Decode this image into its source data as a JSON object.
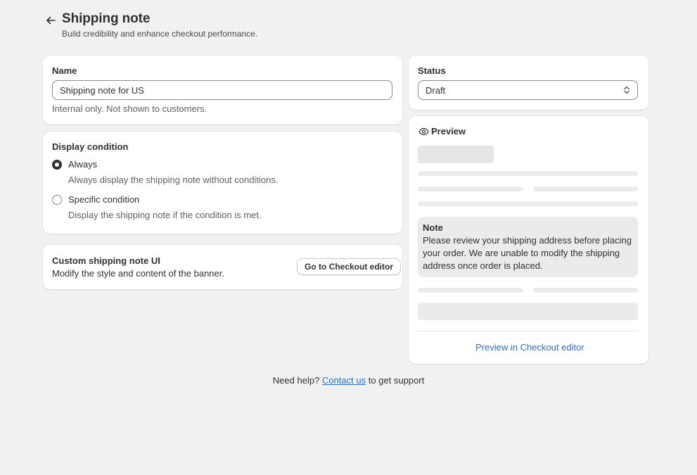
{
  "header": {
    "title": "Shipping note",
    "subtitle": "Build credibility and enhance checkout performance."
  },
  "name_card": {
    "label": "Name",
    "value": "Shipping note for US",
    "help": "Internal only. Not shown to customers."
  },
  "display_condition": {
    "title": "Display condition",
    "options": [
      {
        "label": "Always",
        "description": "Always display the shipping note without conditions.",
        "checked": true
      },
      {
        "label": "Specific condition",
        "description": "Display the shipping note if the condition is met.",
        "checked": false
      }
    ]
  },
  "custom_ui": {
    "title": "Custom shipping note UI",
    "description": "Modify the style and content of the banner.",
    "button_label": "Go to Checkout editor"
  },
  "status_card": {
    "label": "Status",
    "selected": "Draft"
  },
  "preview_card": {
    "title": "Preview",
    "note_title": "Note",
    "note_body": "Please review your shipping address before placing your order. We are unable to modify the shipping address once order is placed.",
    "link_label": "Preview in Checkout editor"
  },
  "footer": {
    "prefix": "Need help?",
    "link": "Contact us",
    "suffix": "to get support"
  },
  "colors": {
    "background": "#f1f1f1",
    "card": "#ffffff",
    "text": "#303030",
    "link": "#2c6ecb",
    "skeleton": "#e6e6e6"
  }
}
